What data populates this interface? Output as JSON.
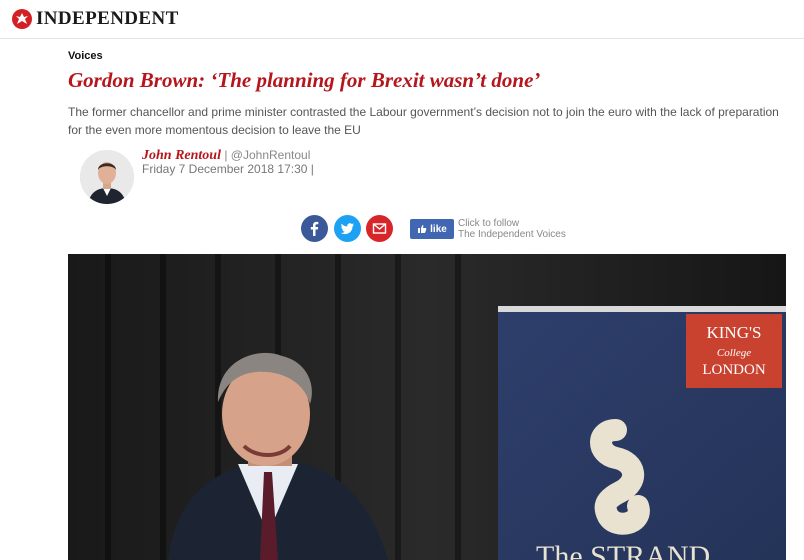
{
  "header": {
    "logo_text": "INDEPENDENT"
  },
  "article": {
    "section": "Voices",
    "headline": "Gordon Brown: ‘The planning for Brexit wasn’t done’",
    "standfirst": "The former chancellor and prime minister contrasted the Labour government’s decision not to join the euro with the lack of preparation for the even more momentous decision to leave the EU",
    "author": "John Rentoul",
    "separator": "|",
    "handle": "@JohnRentoul",
    "date": "Friday 7 December 2018 17:30 |"
  },
  "share": {
    "like_label": "like",
    "follow_line1": "Click to follow",
    "follow_line2": "The Independent Voices"
  },
  "hero": {
    "banner_text_line1": "KING'S",
    "banner_text_line2": "College",
    "banner_text_line3": "LONDON",
    "bottom_text": "The STRAND"
  },
  "colors": {
    "brand_red": "#b5161d",
    "facebook": "#3b5998",
    "twitter": "#1da1f2",
    "email": "#d7262a",
    "like_blue": "#4267b2"
  },
  "icons": [
    "independent-eagle-icon",
    "facebook-icon",
    "twitter-icon",
    "email-icon",
    "thumbs-up-icon"
  ]
}
